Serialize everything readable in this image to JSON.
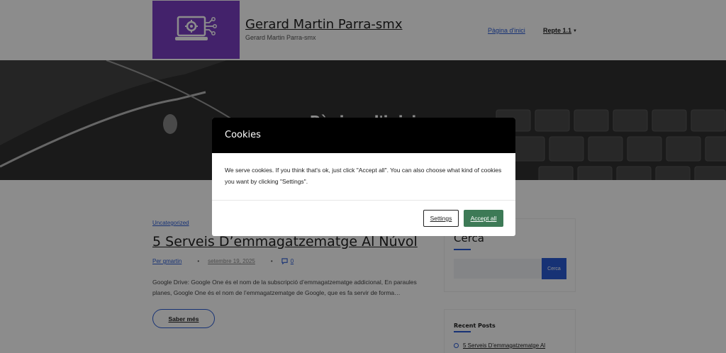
{
  "header": {
    "site_title": "Gerard Martin Parra-smx",
    "tagline": "Gerard Martin Parra-smx",
    "nav": {
      "home": "Pàgina d'inici",
      "repte": "Repte 1.1"
    }
  },
  "hero": {
    "title": "Pàgina d'inici"
  },
  "post": {
    "category": "Uncategorized",
    "title": " 5 Serveis D’emmagatzematge Al Núvol",
    "author": "Per gmartin",
    "date": "setembre 19, 2025",
    "comments": "0",
    "excerpt": "Google Drive: Google One és el nom de la subscripció d’emmagatzematge addicional, En paraules planes, Google One és el nom de l’emmagatzematge de Google, que es fa servir de forma…",
    "read_more": "Saber més"
  },
  "sidebar": {
    "search_heading": "Cerca",
    "search_button": "Cerca",
    "recent_heading": "Recent Posts",
    "recent_items": [
      " 5 Serveis D’emmagatzematge Al"
    ]
  },
  "cookie_modal": {
    "title": "Cookies",
    "body": "We serve cookies. If you think that's ok, just click \"Accept all\". You can also choose what kind of cookies you want by clicking \"Settings\".",
    "settings_label": "Settings",
    "accept_label": "Accept all"
  },
  "colors": {
    "logo_bg": "#7a3fc4",
    "accent": "#2b5cd6",
    "accept_button": "#3d7a56",
    "modal_header": "#000000"
  },
  "icons": {
    "logo": "laptop-gear-icon",
    "comment": "comment-icon",
    "bullet": "circle-bullet-icon",
    "caret": "caret-down-icon"
  }
}
